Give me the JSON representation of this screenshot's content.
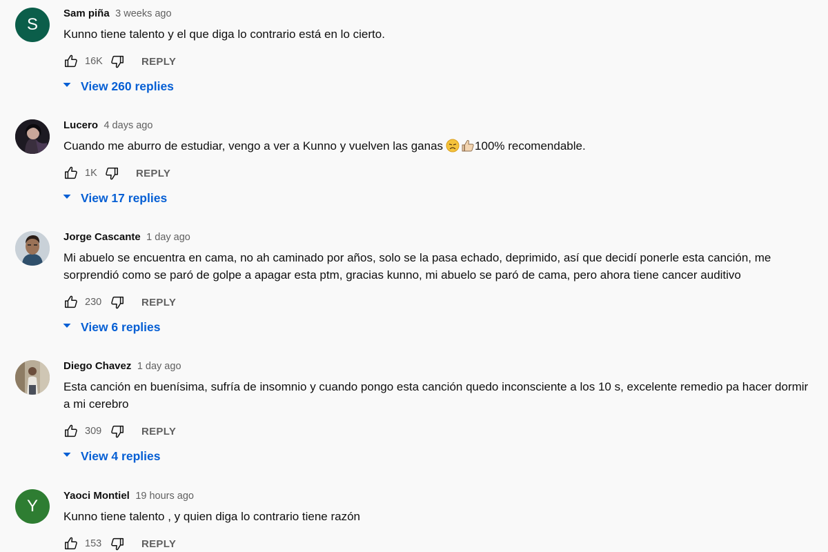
{
  "colors": {
    "link_blue": "#065fd4",
    "secondary_text": "#606060",
    "primary_text": "#0f0f0f",
    "background": "#f9f9f9"
  },
  "icons": {
    "like": "thumb-up-outline",
    "dislike": "thumb-down-outline",
    "expand": "caret-down"
  },
  "reply_label": "REPLY",
  "comments": [
    {
      "author": "Sam piña",
      "time": "3 weeks ago",
      "text": "Kunno tiene talento y el que diga lo contrario está en lo cierto.",
      "likes": "16K",
      "view_replies": "View 260 replies",
      "avatar": {
        "type": "letter",
        "letter": "S",
        "color": "#0b5e4a"
      }
    },
    {
      "author": "Lucero",
      "time": "4 days ago",
      "text": "Cuando me aburro de estudiar, vengo a ver a Kunno y vuelven las ganas",
      "text_emojis": [
        "disappointed-face-emoji",
        "thumbs-up-emoji"
      ],
      "text_tail": "100% recomendable.",
      "likes": "1K",
      "view_replies": "View 17 replies",
      "avatar": {
        "type": "photo",
        "color": "#2a2530"
      }
    },
    {
      "author": "Jorge Cascante",
      "time": "1 day ago",
      "text": "Mi abuelo se encuentra en cama, no ah caminado por años, solo se la pasa echado, deprimido, así que decidí ponerle esta canción, me sorprendió como se paró de golpe a apagar esta ptm, gracias kunno, mi abuelo se paró de cama, pero ahora tiene cancer auditivo",
      "likes": "230",
      "view_replies": "View 6 replies",
      "avatar": {
        "type": "photo",
        "color": "#c9d1d8"
      }
    },
    {
      "author": "Diego Chavez",
      "time": "1 day ago",
      "text": "Esta canción en buenísima, sufría de insomnio y cuando pongo esta canción quedo inconsciente a los 10 s, excelente remedio pa hacer dormir a mi cerebro",
      "likes": "309",
      "view_replies": "View 4 replies",
      "avatar": {
        "type": "photo",
        "color": "#b9ad98"
      }
    },
    {
      "author": "Yaoci Montiel",
      "time": "19 hours ago",
      "text": "Kunno tiene talento , y quien diga lo contrario tiene razón",
      "likes": "153",
      "view_replies": "",
      "avatar": {
        "type": "letter",
        "letter": "Y",
        "color": "#2e7d32"
      }
    }
  ]
}
